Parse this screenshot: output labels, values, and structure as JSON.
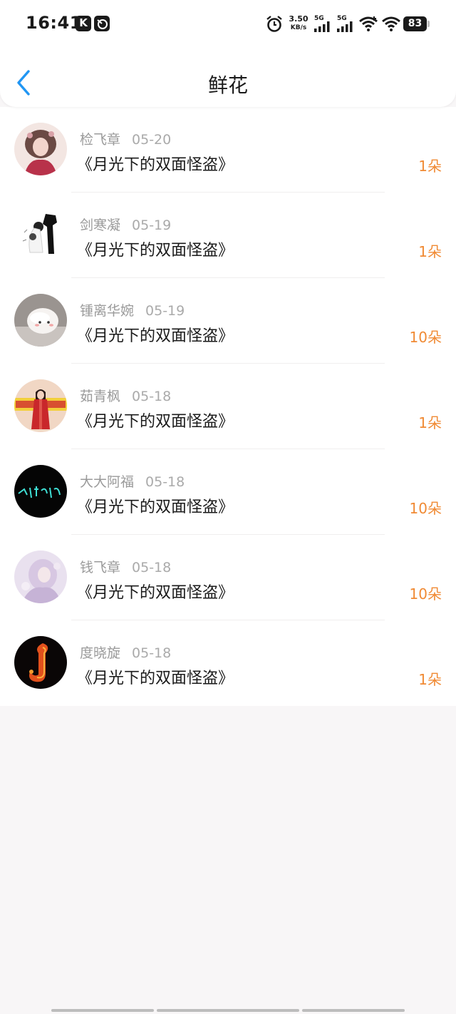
{
  "status_bar": {
    "time": "16:41",
    "app_icon_label": "K",
    "net_speed": "3.50",
    "net_speed_unit": "KB/s",
    "signal1_label": "5G",
    "signal2_label": "5G",
    "battery": "83"
  },
  "header": {
    "title": "鲜花",
    "back_icon": "chevron-left-icon",
    "accent_color": "#2196f3"
  },
  "colors": {
    "count": "#f08a34",
    "meta": "#9a9a9a"
  },
  "items": [
    {
      "name": "检飞章",
      "date": "05-20",
      "book": "《月光下的双面怪盗》",
      "count": "1朵"
    },
    {
      "name": "剑寒凝",
      "date": "05-19",
      "book": "《月光下的双面怪盗》",
      "count": "1朵"
    },
    {
      "name": "锺离华婉",
      "date": "05-19",
      "book": "《月光下的双面怪盗》",
      "count": "10朵"
    },
    {
      "name": "茹青枫",
      "date": "05-18",
      "book": "《月光下的双面怪盗》",
      "count": "1朵"
    },
    {
      "name": "大大阿福",
      "date": "05-18",
      "book": "《月光下的双面怪盗》",
      "count": "10朵"
    },
    {
      "name": "钱飞章",
      "date": "05-18",
      "book": "《月光下的双面怪盗》",
      "count": "10朵"
    },
    {
      "name": "度晓旋",
      "date": "05-18",
      "book": "《月光下的双面怪盗》",
      "count": "1朵"
    }
  ]
}
